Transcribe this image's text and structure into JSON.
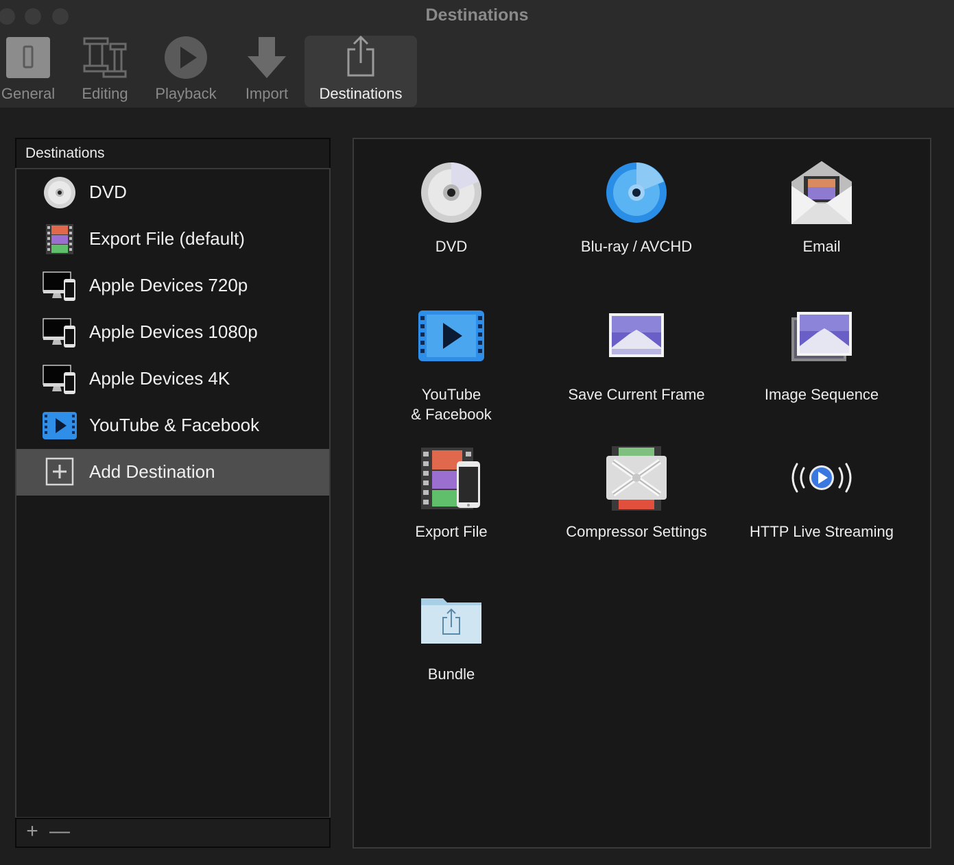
{
  "window": {
    "title": "Destinations"
  },
  "toolbar": {
    "tabs": [
      {
        "label": "General",
        "icon": "switch-icon"
      },
      {
        "label": "Editing",
        "icon": "film-editing-icon"
      },
      {
        "label": "Playback",
        "icon": "play-icon"
      },
      {
        "label": "Import",
        "icon": "download-arrow-icon"
      },
      {
        "label": "Destinations",
        "icon": "share-icon",
        "active": true
      }
    ]
  },
  "sidebar": {
    "header": "Destinations",
    "items": [
      {
        "label": "DVD",
        "icon": "dvd-disc-icon"
      },
      {
        "label": "Export File (default)",
        "icon": "film-strip-icon"
      },
      {
        "label": "Apple Devices 720p",
        "icon": "apple-devices-icon"
      },
      {
        "label": "Apple Devices 1080p",
        "icon": "apple-devices-icon"
      },
      {
        "label": "Apple Devices 4K",
        "icon": "apple-devices-icon"
      },
      {
        "label": "YouTube & Facebook",
        "icon": "video-play-icon"
      },
      {
        "label": "Add Destination",
        "icon": "plus-box-icon",
        "selected": true
      }
    ],
    "footer": {
      "add": "+",
      "remove": "—"
    }
  },
  "destinations_grid": {
    "items": [
      {
        "label": "DVD",
        "icon": "dvd-disc-icon"
      },
      {
        "label": "Blu-ray / AVCHD",
        "icon": "bluray-disc-icon"
      },
      {
        "label": "Email",
        "icon": "email-envelope-icon"
      },
      {
        "label": "YouTube\n& Facebook",
        "icon": "video-play-icon"
      },
      {
        "label": "Save Current Frame",
        "icon": "mountain-picture-icon"
      },
      {
        "label": "Image Sequence",
        "icon": "stacked-pictures-icon"
      },
      {
        "label": "Export File",
        "icon": "film-phone-icon"
      },
      {
        "label": "Compressor Settings",
        "icon": "compressor-icon"
      },
      {
        "label": "HTTP Live Streaming",
        "icon": "live-stream-icon"
      },
      {
        "label": "Bundle",
        "icon": "share-folder-icon"
      }
    ]
  },
  "colors": {
    "background": "#1e1e1e",
    "toolbar": "#2b2b2b",
    "selection": "#4e4e4e",
    "accent_blue": "#2f8fe8"
  }
}
